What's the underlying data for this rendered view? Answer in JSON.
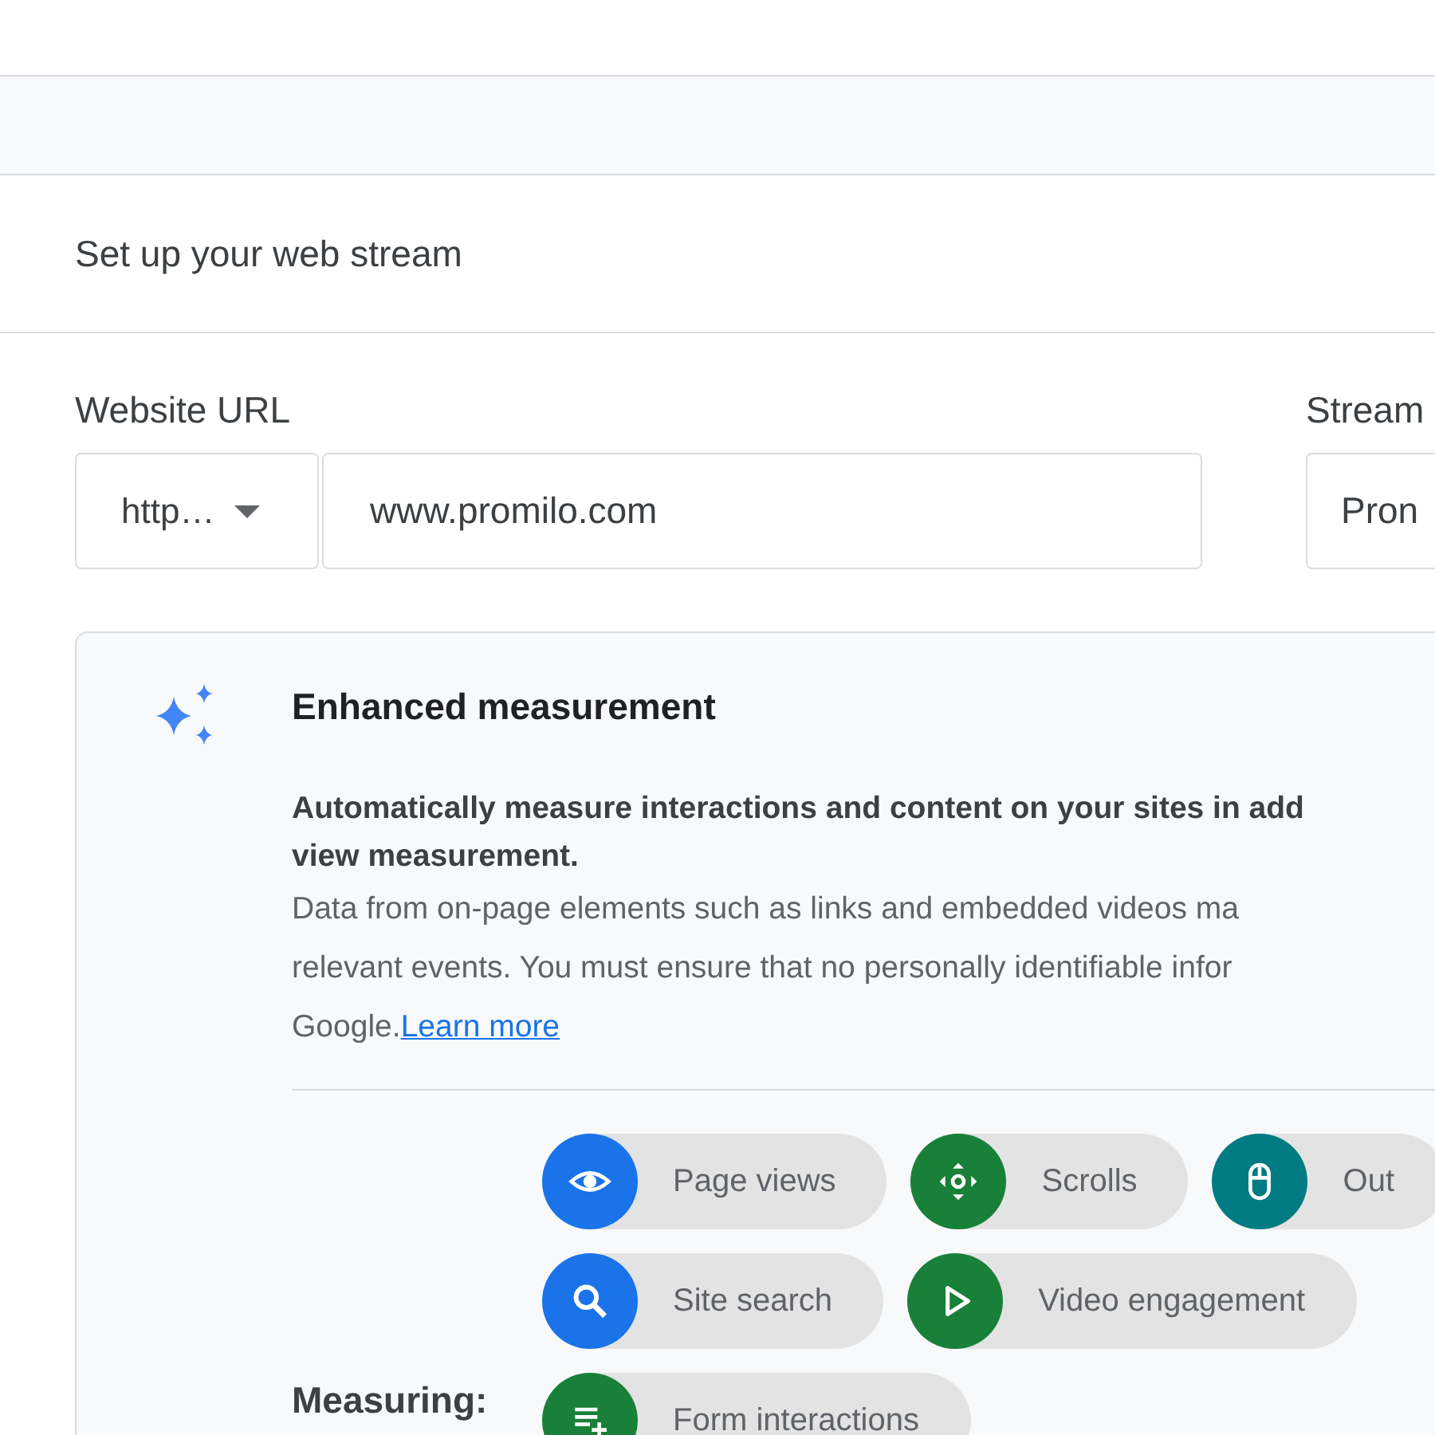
{
  "section_title": "Set up your web stream",
  "website_url": {
    "label": "Website URL",
    "protocol": "http…",
    "value": "www.promilo.com"
  },
  "stream_name": {
    "label": "Stream",
    "value": "Pron"
  },
  "enhanced_measurement": {
    "title": "Enhanced measurement",
    "bold_lines": [
      "Automatically measure interactions and content on your sites in add",
      "view measurement."
    ],
    "lines": [
      "Data from on-page elements such as links and embedded videos ma",
      "relevant events. You must ensure that no personally identifiable infor"
    ],
    "last_line": "Google.",
    "link": "Learn more",
    "measuring_label": "Measuring:",
    "chips": [
      {
        "label": "Page views",
        "kind": "eye",
        "color": "#1a73e8"
      },
      {
        "label": "Scrolls",
        "kind": "scroll",
        "color": "#188038"
      },
      {
        "label": "Out",
        "kind": "mouse",
        "color": "#007b83"
      },
      {
        "label": "Site search",
        "kind": "search",
        "color": "#1a73e8"
      },
      {
        "label": "Video engagement",
        "kind": "play",
        "color": "#188038"
      },
      {
        "label": "Form interactions",
        "kind": "form",
        "color": "#188038"
      }
    ]
  }
}
